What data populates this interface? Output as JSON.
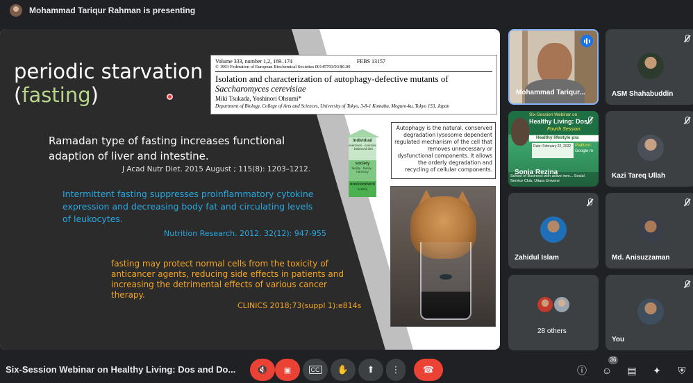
{
  "presenting_banner": "Mohammad Tariqur Rahman is presenting",
  "slide": {
    "title_line1": "periodic starvation",
    "title_paren_open": "(",
    "title_highlight": "fasting",
    "title_paren_close": ")",
    "point1": "Ramadan type of fasting increases functional adaption of liver and intestine.",
    "ref1": "J Acad Nutr Diet. 2015 August ; 115(8): 1203–1212.",
    "point2": "Intermittent fasting suppresses proinflammatory cytokine expression and decreasing body fat and circulating levels of leukocytes.",
    "ref2": "Nutrition Research. 2012. 32(12): 947-955",
    "point3": "fasting may protect normal cells from the toxicity of anticancer agents, reducing side effects in patients and increasing the detrimental effects of various cancer therapy.",
    "ref3": "CLINICS 2018;73(suppl 1):e814s",
    "journal": {
      "volume": "Volume 333, number 1,2, 169–174",
      "febs": "FEBS 13157",
      "copyright": "© 1993 Federation of European Biochemical Societies 00145793/93/$6.00",
      "title": "Isolation and characterization of autophagy-defective mutants of",
      "species": "Saccharomyces cerevisiae",
      "authors": "Miki Tsukada, Yoshinori Ohsumi*",
      "department": "Department of Biology, College of Arts and Sciences, University of Tokyo, 3-8-1 Komaba, Meguro-ku, Tokyo 153, Japan"
    },
    "arrow": {
      "level1": "individual",
      "level1_sub": "exercises · exercise · balanced diet",
      "level2": "society",
      "level2_sub": "facility · family · harmony",
      "level3": "environment",
      "level3_sub": "healthy"
    },
    "autophagy_text": "Autophagy is the natural, conserved degradation lysosome dependent regulated mechanism of the cell that removes unnecessary or dysfunctional components. It allows the orderly degradation and recycling of cellular components."
  },
  "participants": {
    "presenter_name": "Mohammad Tariqur...",
    "asm": "ASM Shahabuddin",
    "sonia": "Sonia Rezina",
    "kazi": "Kazi Tareq Ullah",
    "zahidul": "Zahidul Islam",
    "anisuzzaman": "Md. Anisuzzaman",
    "others": "28 others",
    "you": "You"
  },
  "webinar_tile": {
    "line1": "Six-Session Webinar on",
    "line2": "Healthy Living: Dos",
    "line3": "Fourth Session:",
    "bar": "Healthy lifestyle pra",
    "card": "Date: February 22, 2022",
    "platform": "Platform:",
    "gm": "Google m",
    "footer": "School of Business with active invo... Social Service Club, Uttara Universi"
  },
  "bottom": {
    "meeting_title": "Six-Session Webinar on Healthy Living: Dos and Do...",
    "participant_count": "36"
  }
}
